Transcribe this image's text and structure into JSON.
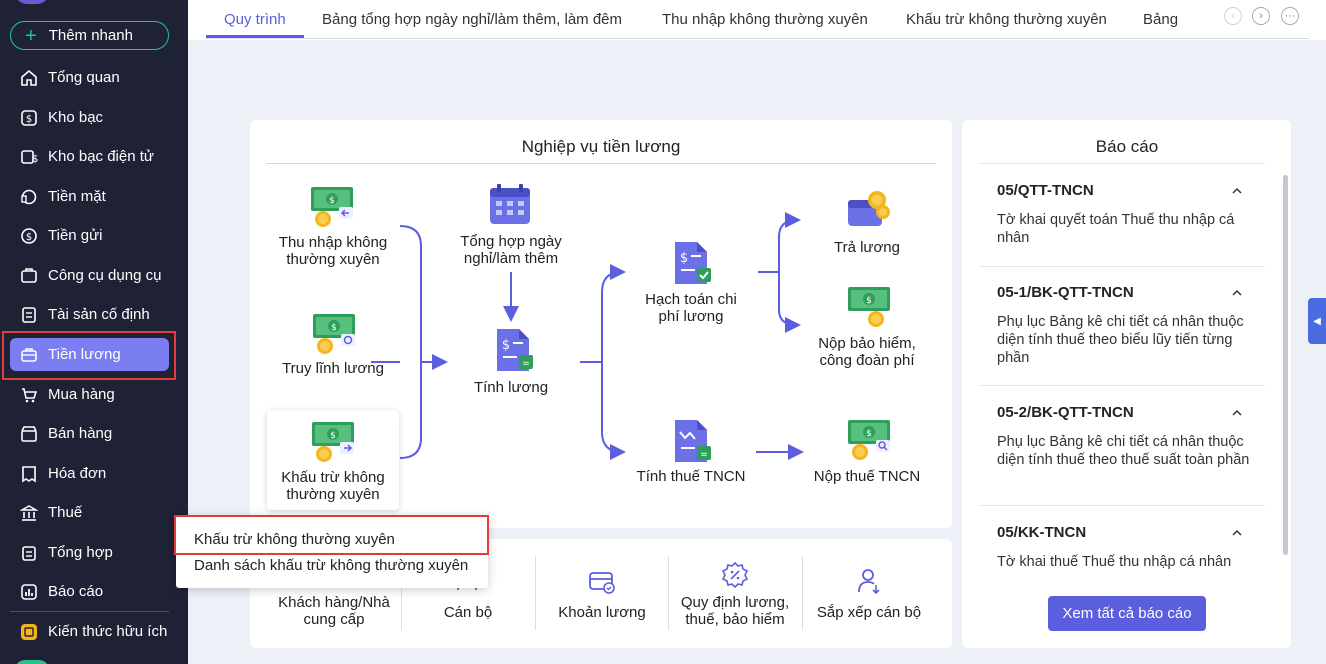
{
  "sidebar": {
    "quick_add": "Thêm nhanh",
    "items": [
      {
        "label": "Tổng quan",
        "icon": "home-icon"
      },
      {
        "label": "Kho bạc",
        "icon": "treasury-icon"
      },
      {
        "label": "Kho bạc điện tử",
        "icon": "e-treasury-icon"
      },
      {
        "label": "Tiền mặt",
        "icon": "cash-icon"
      },
      {
        "label": "Tiền gửi",
        "icon": "deposit-icon"
      },
      {
        "label": "Công cụ dụng cụ",
        "icon": "tools-icon"
      },
      {
        "label": "Tài sản cố định",
        "icon": "assets-icon"
      },
      {
        "label": "Tiền lương",
        "icon": "payroll-icon"
      },
      {
        "label": "Mua hàng",
        "icon": "cart-icon"
      },
      {
        "label": "Bán hàng",
        "icon": "sales-icon"
      },
      {
        "label": "Hóa đơn",
        "icon": "invoice-icon"
      },
      {
        "label": "Thuế",
        "icon": "tax-icon"
      },
      {
        "label": "Tổng hợp",
        "icon": "summary-icon"
      },
      {
        "label": "Báo cáo",
        "icon": "report-icon"
      },
      {
        "label": "Kiến thức hữu ích",
        "icon": "knowledge-icon"
      }
    ],
    "active_index": 7
  },
  "tabs": [
    "Quy trình",
    "Bảng tổng hợp ngày nghỉ/làm thêm, làm đêm",
    "Thu nhập không thường xuyên",
    "Khấu trừ không thường xuyên",
    "Bảng"
  ],
  "workflow": {
    "title": "Nghiệp vụ tiền lương",
    "income_irregular": [
      "Thu nhập không",
      "thường xuyên"
    ],
    "payroll_refund": "Truy lĩnh lương",
    "deduction_irregular": [
      "Khấu trừ không",
      "thường xuyên"
    ],
    "timesheet_summary": [
      "Tổng hợp ngày",
      "nghỉ/làm thêm"
    ],
    "calc_salary": "Tính lương",
    "accounting": [
      "Hạch toán chi",
      "phí lương"
    ],
    "calc_pit": "Tính thuế TNCN",
    "pay_salary": "Trả lương",
    "pay_insurance": [
      "Nộp bảo hiểm,",
      "công đoàn phí"
    ],
    "pay_pit": "Nộp thuế TNCN"
  },
  "categories": {
    "customer_supplier": [
      "Khách hàng/Nhà",
      "cung cấp"
    ],
    "staff": "Cán bộ",
    "salary_item": "Khoản lương",
    "regulations": [
      "Quy định lương,",
      "thuế, bảo hiểm"
    ],
    "arrange_staff": "Sắp xếp cán bộ"
  },
  "dropdown": [
    "Khấu trừ không thường xuyên",
    "Danh sách khấu trừ không thường xuyên"
  ],
  "reports": {
    "title": "Báo cáo",
    "items": [
      {
        "code": "05/QTT-TNCN",
        "desc": "Tờ khai quyết toán Thuế thu nhập cá nhân"
      },
      {
        "code": "05-1/BK-QTT-TNCN",
        "desc": "Phụ lục Bảng kê chi tiết cá nhân thuộc diện tính thuế theo biểu lũy tiến từng phần"
      },
      {
        "code": "05-2/BK-QTT-TNCN",
        "desc": "Phụ lục Bảng kê chi tiết cá nhân thuộc diện tính thuế theo thuế suất toàn phần"
      },
      {
        "code": "05/KK-TNCN",
        "desc": "Tờ khai thuế Thuế thu nhập cá nhân"
      }
    ],
    "view_all": "Xem tất cả báo cáo"
  },
  "colors": {
    "accent": "#5b5fde",
    "sidebar_bg": "#1f2235",
    "active_item": "#7b7ef0",
    "highlight_border": "#e43b3b",
    "money_green": "#2e9e5b",
    "coin": "#f4b61b"
  }
}
